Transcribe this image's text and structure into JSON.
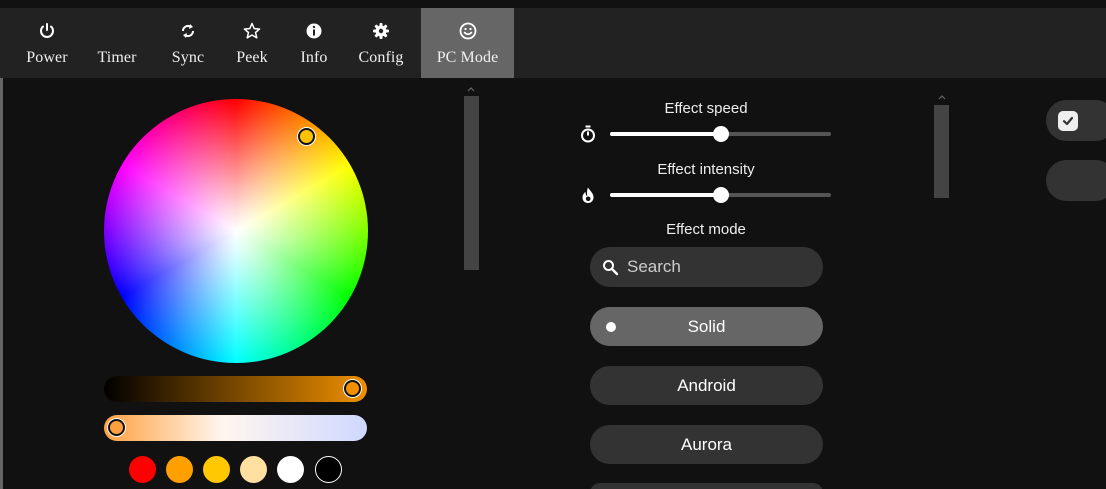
{
  "nav": {
    "power": "Power",
    "timer": "Timer",
    "sync": "Sync",
    "peek": "Peek",
    "info": "Info",
    "config": "Config",
    "pc_mode": "PC Mode"
  },
  "color": {
    "hue_knob_color": "#ffc200",
    "brightness_color": "#f09000",
    "temperature_color": "#ffa040",
    "swatches": [
      "#ff0000",
      "#ffa000",
      "#ffc800",
      "#ffe0a0",
      "#ffffff",
      "#000000"
    ]
  },
  "effects": {
    "speed_label": "Effect speed",
    "speed_value": 0.5,
    "intensity_label": "Effect intensity",
    "intensity_value": 0.5,
    "mode_label": "Effect mode",
    "search_placeholder": "Search",
    "modes": [
      "Solid",
      "Android",
      "Aurora"
    ],
    "selected_mode": "Solid"
  }
}
